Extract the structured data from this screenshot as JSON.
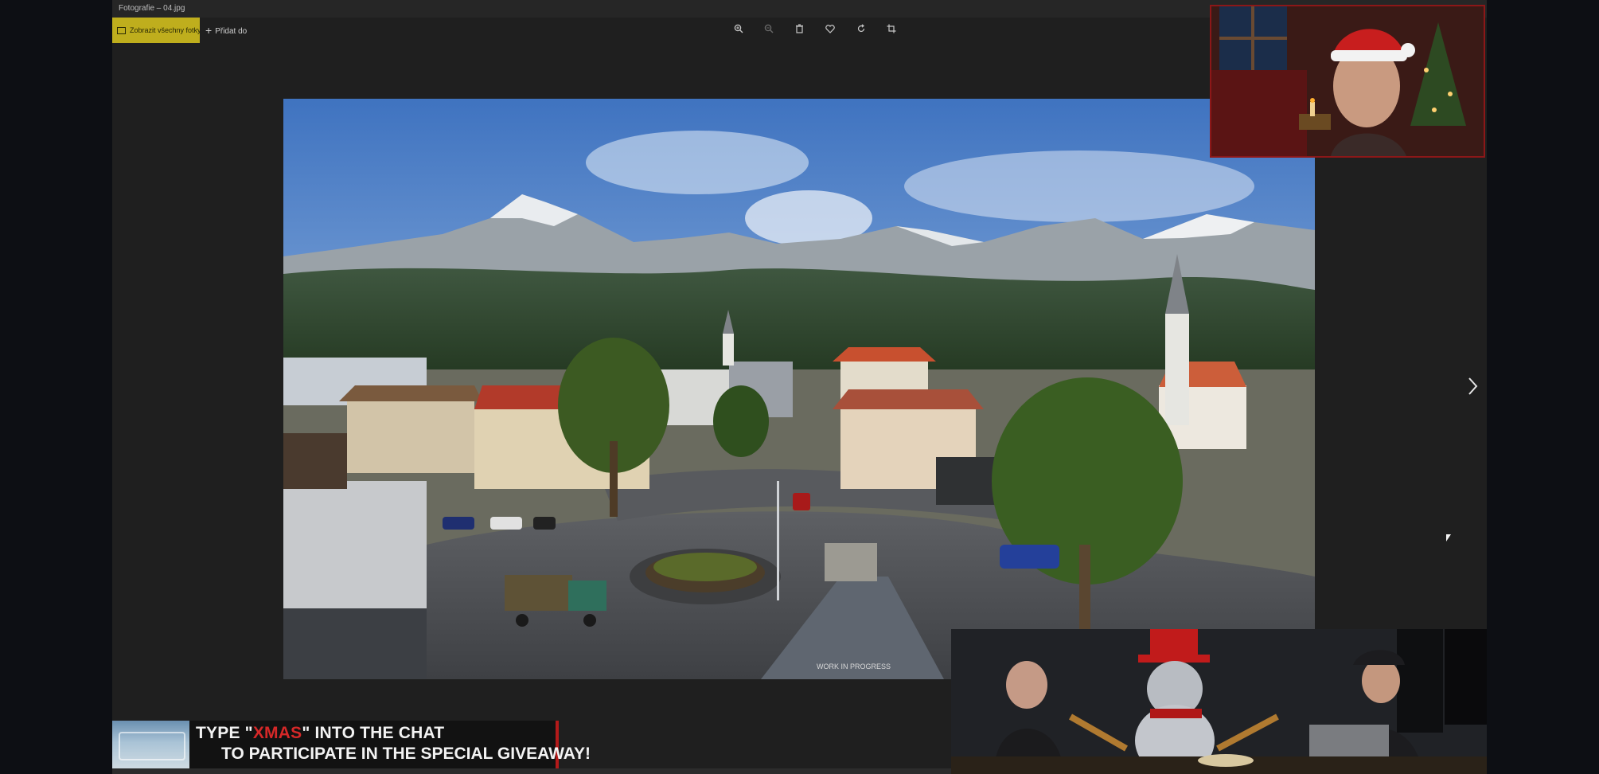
{
  "window": {
    "title": "Fotografie – 04.jpg"
  },
  "toolbar": {
    "slideshow_label": "Zobrazit všechny fotky",
    "add_label": "Přidat do",
    "icons": [
      "zoom-in-icon",
      "zoom-out-icon",
      "delete-icon",
      "favorite-icon",
      "rotate-icon",
      "crop-icon"
    ]
  },
  "viewer": {
    "watermark": "WORK IN PROGRESS",
    "next_label": "›"
  },
  "overlay": {
    "line1_pre": "TYPE \"",
    "line1_highlight": "XMAS",
    "line1_post": "\" INTO THE CHAT",
    "line2": "TO PARTICIPATE IN THE SPECIAL GIVEAWAY!",
    "accent": "#d62828"
  },
  "colors": {
    "toolbar_accent": "#bfae1d",
    "webcam_border": "#8c1718"
  }
}
